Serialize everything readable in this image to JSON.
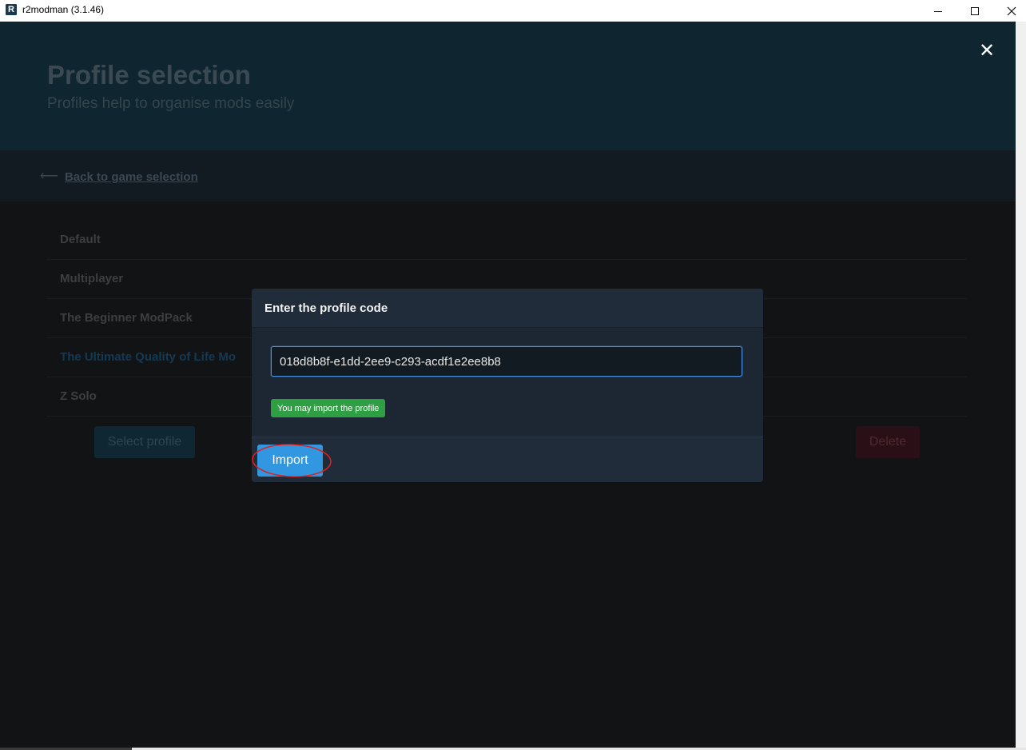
{
  "window": {
    "title": "r2modman (3.1.46)",
    "app_icon_letter": "R",
    "minimize_icon": "minimize-icon",
    "maximize_icon": "maximize-icon",
    "close_icon": "close-icon"
  },
  "hero": {
    "title": "Profile selection",
    "subtitle": "Profiles help to organise mods easily"
  },
  "back": {
    "arrow": "⟵",
    "label": "Back to game selection"
  },
  "profiles": [
    {
      "name": "Default",
      "selected": false
    },
    {
      "name": "Multiplayer",
      "selected": false
    },
    {
      "name": "The Beginner ModPack",
      "selected": false
    },
    {
      "name": "The Ultimate Quality of Life Mo",
      "selected": true
    },
    {
      "name": "Z Solo",
      "selected": false
    }
  ],
  "actions": {
    "select_label": "Select profile",
    "delete_label": "Delete"
  },
  "modal": {
    "close_glyph": "✕",
    "title": "Enter the profile code",
    "code_value": "018d8b8f-e1dd-2ee9-c293-acdf1e2ee8b8",
    "status": "You may import the profile",
    "import_label": "Import"
  },
  "colors": {
    "accent": "#3097e0",
    "success": "#2ea043",
    "annotation": "#e02020"
  }
}
